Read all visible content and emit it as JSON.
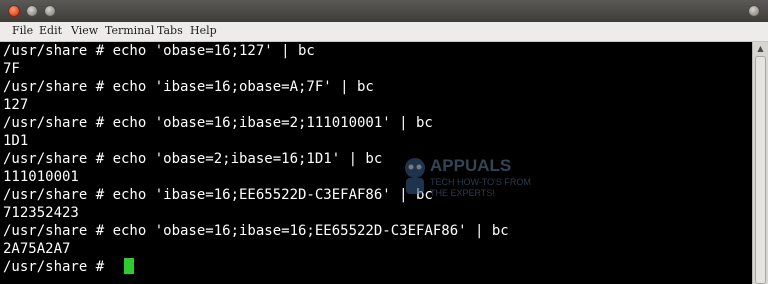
{
  "menu": [
    "File",
    "Edit",
    "View",
    "Terminal",
    "Tabs",
    "Help"
  ],
  "terminal": {
    "lines": [
      "/usr/share # echo 'obase=16;127' | bc",
      "7F",
      "/usr/share # echo 'ibase=16;obase=A;7F' | bc",
      "127",
      "/usr/share # echo 'obase=16;ibase=2;111010001' | bc",
      "1D1",
      "/usr/share # echo 'obase=2;ibase=16;1D1' | bc",
      "111010001",
      "/usr/share # echo 'ibase=16;EE65522D-C3EFAF86' | bc",
      "712352423",
      "/usr/share # echo 'obase=16;ibase=16;EE65522D-C3EFAF86' | bc",
      "2A75A2A7",
      "/usr/share # "
    ]
  },
  "watermark": {
    "brand": "APPUALS",
    "tagline_1": "TECH HOW-TO'S FROM",
    "tagline_2": "THE EXPERTS!"
  },
  "colors": {
    "cursor": "#2ecc2e",
    "close_button": "#e2552c",
    "terminal_bg": "#000000",
    "terminal_fg": "#ffffff"
  }
}
